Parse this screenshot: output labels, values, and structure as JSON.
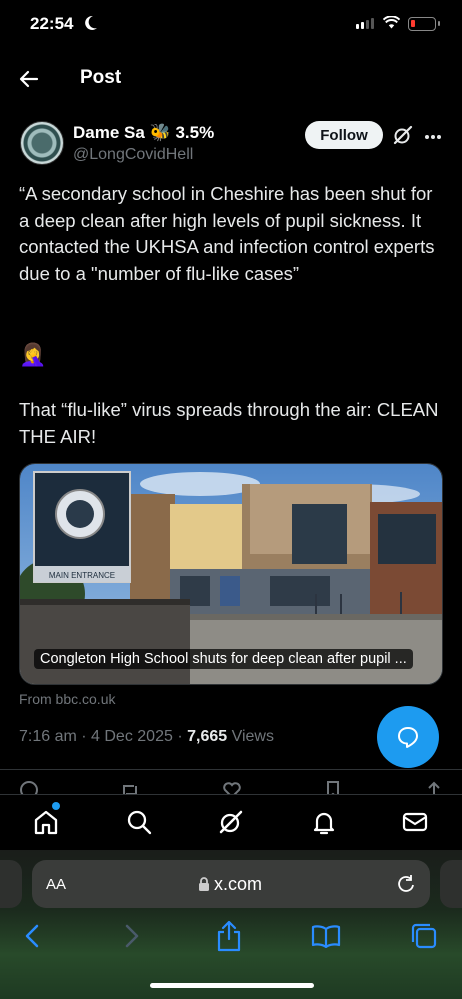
{
  "status_bar": {
    "time": "22:54"
  },
  "header": {
    "title": "Post"
  },
  "author": {
    "name": "Dame Sa",
    "name_suffix": "3.5%",
    "handle": "@LongCovidHell",
    "follow_label": "Follow"
  },
  "post": {
    "text": "“A secondary school in Cheshire has been shut for a deep clean after high levels of pupil sickness. It contacted the UKHSA and infection control experts due to a \"number of flu-like cases”",
    "emoji": "🤦‍♀️",
    "text2": "That “flu-like” virus spreads through the air: CLEAN THE AIR!",
    "card_caption": "Congleton High School shuts for deep clean after pupil ...",
    "card_source": "From bbc.co.uk",
    "sign_text": "MAIN ENTRANCE",
    "time": "7:16 am · 4 Dec 2025 · ",
    "views_count": "7,665",
    "views_label": " Views"
  },
  "colors": {
    "accent": "#1d9bf0",
    "background": "#000000",
    "muted": "#71767b"
  },
  "tabbar": {
    "items": [
      "home-icon",
      "search-icon",
      "grok-icon",
      "notifications-icon",
      "messages-icon"
    ]
  },
  "safari": {
    "aa_label": "AA",
    "url": "x.com"
  }
}
